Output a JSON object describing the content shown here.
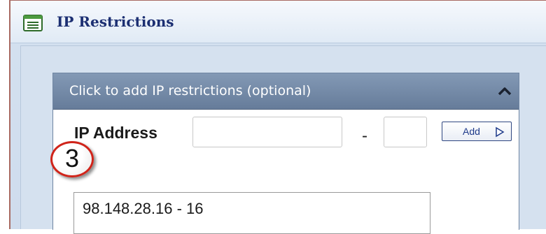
{
  "window": {
    "title": "IP Restrictions",
    "icon": "list-window-icon"
  },
  "panel": {
    "header": "Click to add IP restrictions (optional)",
    "collapse_icon": "chevron-up-icon",
    "ip_label": "IP Address",
    "ip_value": "",
    "range_separator": "-",
    "range_value": "",
    "add_button_label": "Add",
    "add_button_icon": "triangle-right-icon"
  },
  "annotation": {
    "step_number": "3"
  },
  "ip_list": {
    "items": [
      "98.148.28.16 - 16"
    ]
  },
  "colors": {
    "header_bg": "#7189a8",
    "title_text": "#1c2f72",
    "badge_border": "#d0241a",
    "button_border": "#2e4680"
  }
}
